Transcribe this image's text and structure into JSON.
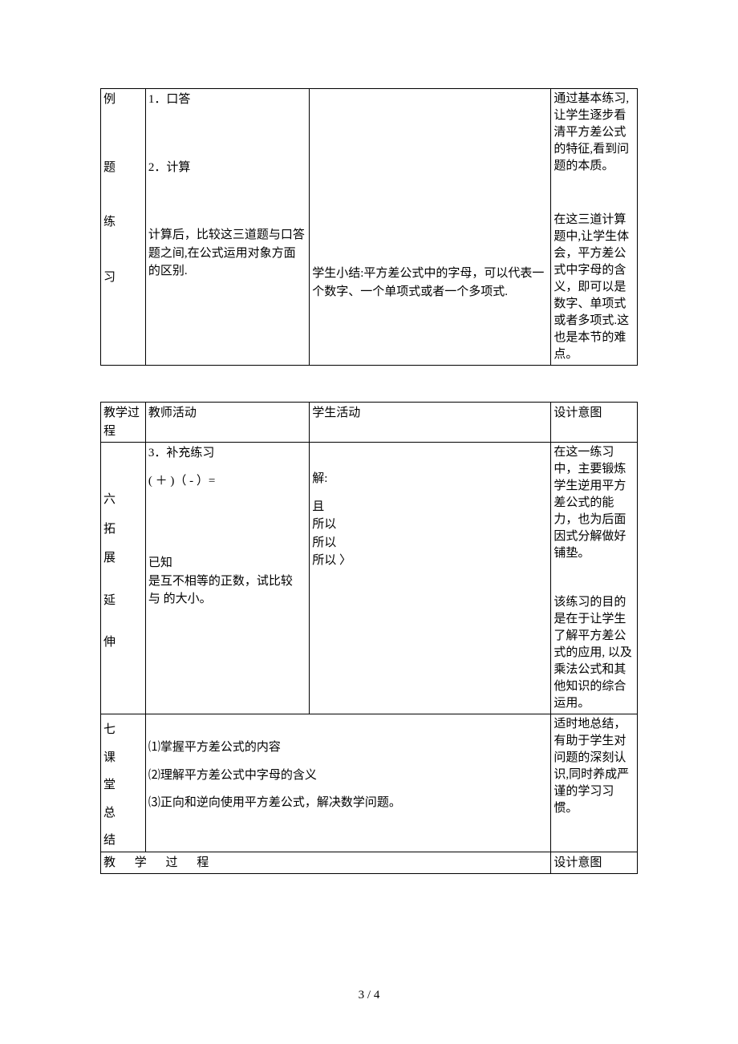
{
  "table1": {
    "col1": [
      "例",
      "题",
      "练",
      "习"
    ],
    "col2": {
      "p1": "1．口答",
      "p2": "2．计算",
      "p3": "计算后，比较这三道题与口答题之间,在公式运用对象方面的区别."
    },
    "col3": "学生小结:平方差公式中的字母，可以代表一个数字、一个单项式或者一个多项式.",
    "col4a": "通过基本练习,让学生逐步看清平方差公式的特征,看到问题的本质。",
    "col4b": "在这三道计算题中,让学生体会，平方差公式中字母的含义，即可以是数字、单项式或者多项式.这也是本节的难点。"
  },
  "table2": {
    "hdr": {
      "a": "教学过程",
      "b": "教师活动",
      "c": "学生活动",
      "d": "设计意图"
    },
    "r1": {
      "col1": [
        "六",
        "拓",
        "展",
        "延",
        "伸"
      ],
      "b1": "3．补充练习",
      "b2": "( ＋ )（ - ）=",
      "b3": "已知",
      "b4": "是互不相等的正数，试比较   与   的大小。",
      "c1": "解:",
      "c2": "且",
      "c3": "所以",
      "c4": "所以",
      "c5": "所以 〉",
      "d1": "在这一练习中，主要锻炼学生逆用平方差公式的能力，也为后面因式分解做好铺垫。",
      "d2": "该练习的目的是在于让学生了解平方差公式的应用, 以及乘法公式和其他知识的综合运用。"
    },
    "r2": {
      "col1": [
        "七",
        "课",
        "堂",
        "总",
        "结"
      ],
      "p1": "⑴掌握平方差公式的内容",
      "p2": "⑵理解平方差公式中字母的含义",
      "p3": "⑶正向和逆向使用平方差公式，解决数学问题。",
      "d": "适时地总结，有助于学生对问题的深刻认识,同时养成严谨的学习习惯。"
    },
    "r3": {
      "b": "教 学 过 程",
      "d": "设计意图"
    }
  },
  "pagenum": "3 / 4"
}
